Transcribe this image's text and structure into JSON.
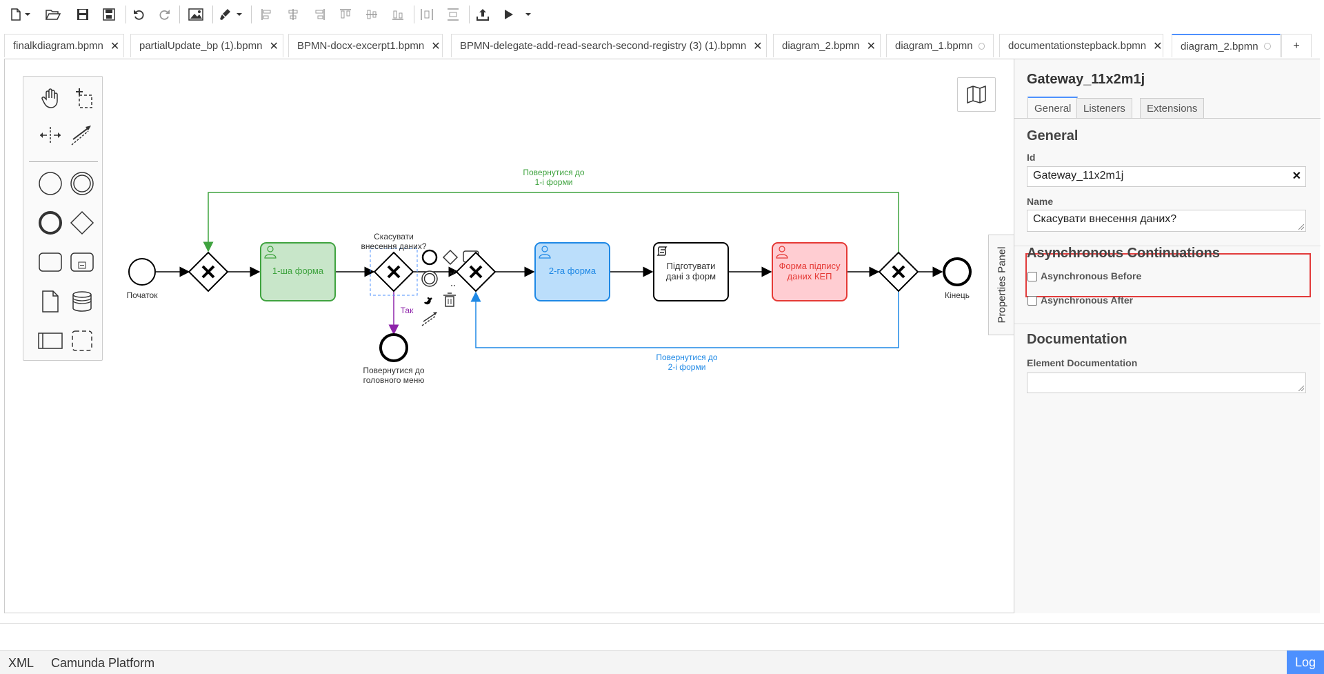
{
  "tabs": [
    {
      "label": "finalkdiagram.bpmn",
      "marker": "close"
    },
    {
      "label": "partialUpdate_bp (1).bpmn",
      "marker": "close"
    },
    {
      "label": "BPMN-docx-excerpt1.bpmn",
      "marker": "close"
    },
    {
      "label": "BPMN-delegate-add-read-search-second-registry (3) (1).bpmn",
      "marker": "close"
    },
    {
      "label": "diagram_2.bpmn",
      "marker": "close"
    },
    {
      "label": "diagram_1.bpmn",
      "marker": "dot"
    },
    {
      "label": "documentationstepback.bpmn",
      "marker": "close"
    },
    {
      "label": "diagram_2.bpmn",
      "marker": "dot",
      "active": true
    }
  ],
  "tab_add_label": "+",
  "tab_close_glyph": "✕",
  "diagram": {
    "start_label": "Початок",
    "task1": "1-ша форма",
    "gateway2_label_line1": "Скасувати",
    "gateway2_label_line2": "внесення даних?",
    "flow_yes": "Так",
    "end_menu_line1": "Повернутися до",
    "end_menu_line2": "головного меню",
    "task2": "2-га форма",
    "task3_line1": "Підготувати",
    "task3_line2": "дані з форм",
    "task4_line1": "Форма підпису",
    "task4_line2": "даних КЕП",
    "end_label": "Кінець",
    "loop1_line1": "Повернутися до",
    "loop1_line2": "1-і форми",
    "loop2_line1": "Повернутися до",
    "loop2_line2": "2-і форми",
    "colors": {
      "green": "#3fa33f",
      "green_fill": "#c8e6c9",
      "blue": "#1e88e5",
      "blue_fill": "#bbdefb",
      "red": "#e53935",
      "red_fill": "#ffcdd2",
      "purple": "#8e24aa"
    }
  },
  "properties": {
    "toggle_label": "Properties Panel",
    "title": "Gateway_11x2m1j",
    "tabs": [
      "General",
      "Listeners",
      "Extensions"
    ],
    "general_title": "General",
    "id_label": "Id",
    "id_value": "Gateway_11x2m1j",
    "clear_glyph": "✕",
    "name_label": "Name",
    "name_value": "Скасувати внесення даних?",
    "async_title": "Asynchronous Continuations",
    "async_before": "Asynchronous Before",
    "async_after": "Asynchronous After",
    "doc_title": "Documentation",
    "doc_label": "Element Documentation"
  },
  "status": {
    "xml": "XML",
    "platform": "Camunda Platform",
    "log": "Log"
  }
}
